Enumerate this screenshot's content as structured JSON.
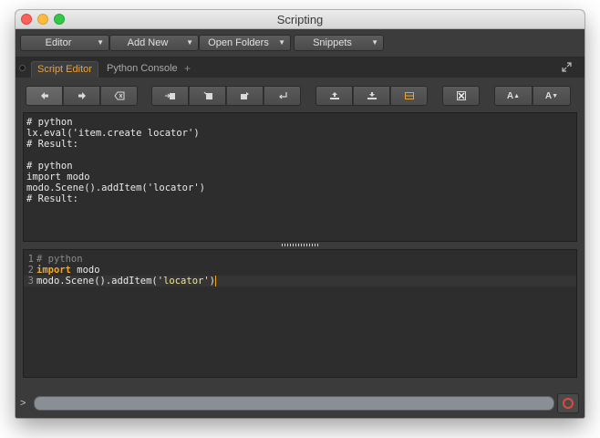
{
  "window": {
    "title": "Scripting"
  },
  "menubar": [
    {
      "label": "Editor"
    },
    {
      "label": "Add New"
    },
    {
      "label": "Open Folders"
    },
    {
      "label": "Snippets"
    }
  ],
  "tabs": [
    {
      "label": "Script Editor",
      "active": true
    },
    {
      "label": "Python Console",
      "active": false
    }
  ],
  "tab_add": "+",
  "toolbar": {
    "font_increase": "A",
    "font_decrease": "A"
  },
  "output": [
    "# python",
    "lx.eval('item.create locator')",
    "# Result:",
    "",
    "# python",
    "import modo",
    "modo.Scene().addItem('locator')",
    "# Result:"
  ],
  "editor": {
    "line_numbers": [
      "1",
      "2",
      "3"
    ],
    "line1": "# python",
    "line2_kw": "import",
    "line2_rest": " modo",
    "line3_pre": "modo.Scene().addItem(",
    "line3_str": "'locator'",
    "line3_post": ")"
  },
  "command": {
    "prompt": ">",
    "value": ""
  },
  "colors": {
    "accent": "#e6a23c",
    "keyword": "#f3a71c",
    "string": "#f0e68c",
    "record": "#e0493e"
  }
}
